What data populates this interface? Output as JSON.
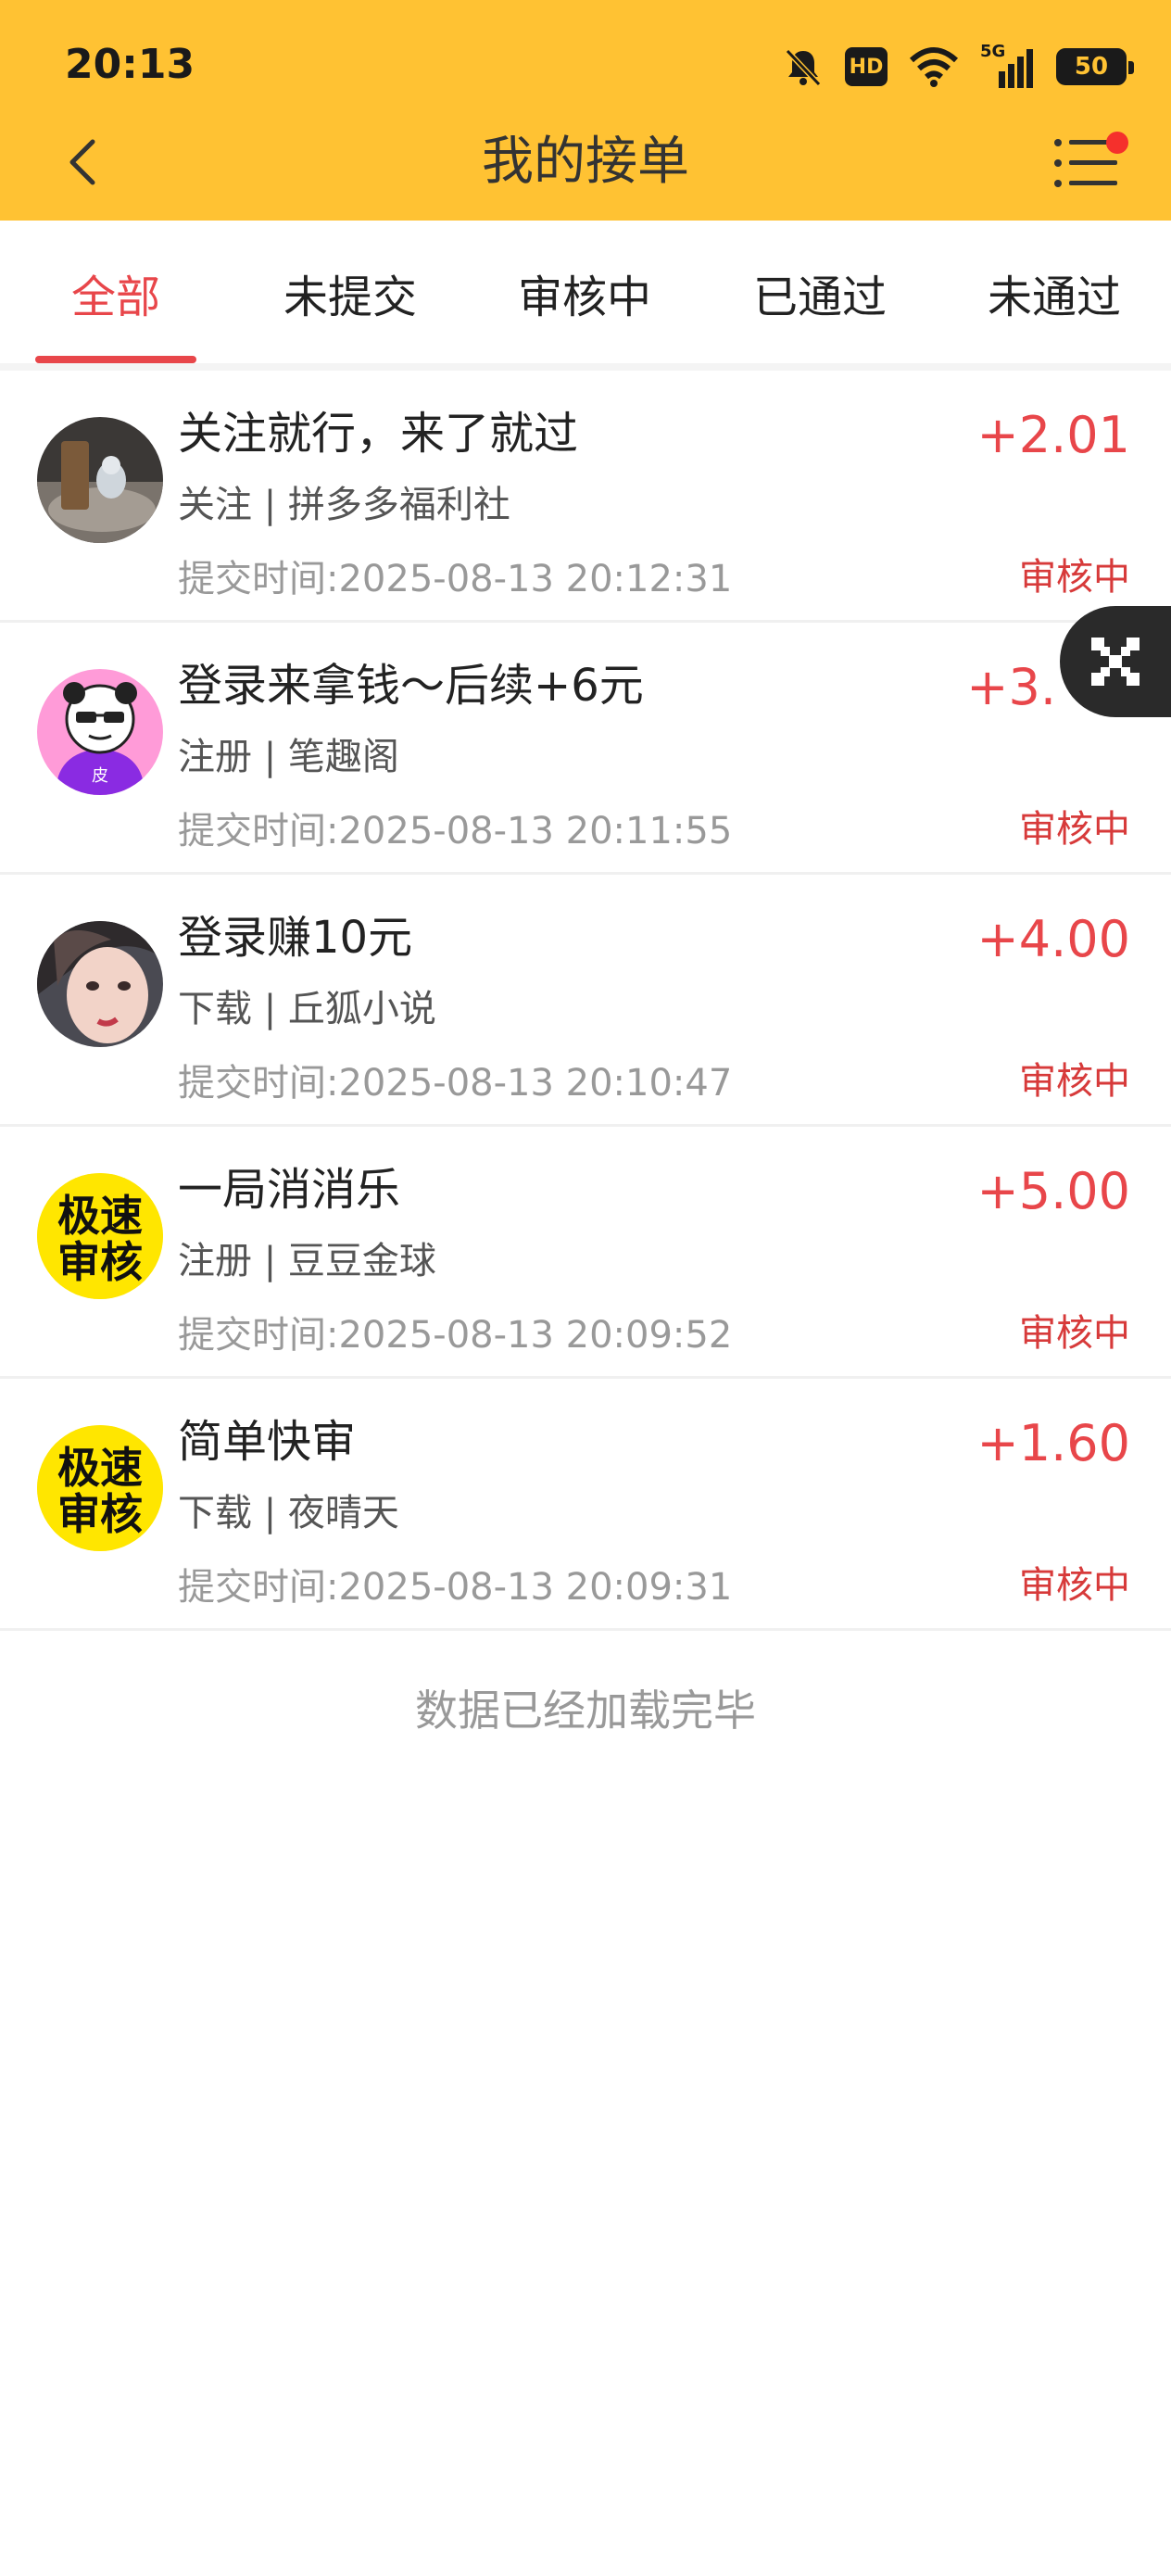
{
  "status_bar": {
    "time": "20:13",
    "hd_badge": "HD",
    "network": "5G",
    "battery": "50"
  },
  "header": {
    "title": "我的接单"
  },
  "tabs": [
    {
      "label": "全部",
      "active": true
    },
    {
      "label": "未提交",
      "active": false
    },
    {
      "label": "审核中",
      "active": false
    },
    {
      "label": "已通过",
      "active": false
    },
    {
      "label": "未通过",
      "active": false
    }
  ],
  "orders": [
    {
      "title": "关注就行，来了就过",
      "subtitle": "关注 | 拼多多福利社",
      "time": "提交时间:2025-08-13 20:12:31",
      "amount": "+2.01",
      "status": "审核中"
    },
    {
      "title": "登录来拿钱～后续+6元",
      "subtitle": "注册 | 笔趣阁",
      "time": "提交时间:2025-08-13 20:11:55",
      "amount": "+3.",
      "status": "审核中"
    },
    {
      "title": "登录赚10元",
      "subtitle": "下载 | 丘狐小说",
      "time": "提交时间:2025-08-13 20:10:47",
      "amount": "+4.00",
      "status": "审核中"
    },
    {
      "title": "一局消消乐",
      "subtitle": "注册 | 豆豆金球",
      "time": "提交时间:2025-08-13 20:09:52",
      "amount": "+5.00",
      "status": "审核中"
    },
    {
      "title": "简单快审",
      "subtitle": "下载 | 夜晴天",
      "time": "提交时间:2025-08-13 20:09:31",
      "amount": "+1.60",
      "status": "审核中"
    }
  ],
  "avatars": {
    "avatar_4_text": [
      "极速",
      "审核"
    ],
    "avatar_5_text": [
      "极速",
      "审核"
    ],
    "avatar_2_text": "皮"
  },
  "footer": {
    "note": "数据已经加载完毕"
  },
  "colors": {
    "header_bg": "#FFC233",
    "accent_red": "#E8464A",
    "status_red": "#D73A3A"
  }
}
